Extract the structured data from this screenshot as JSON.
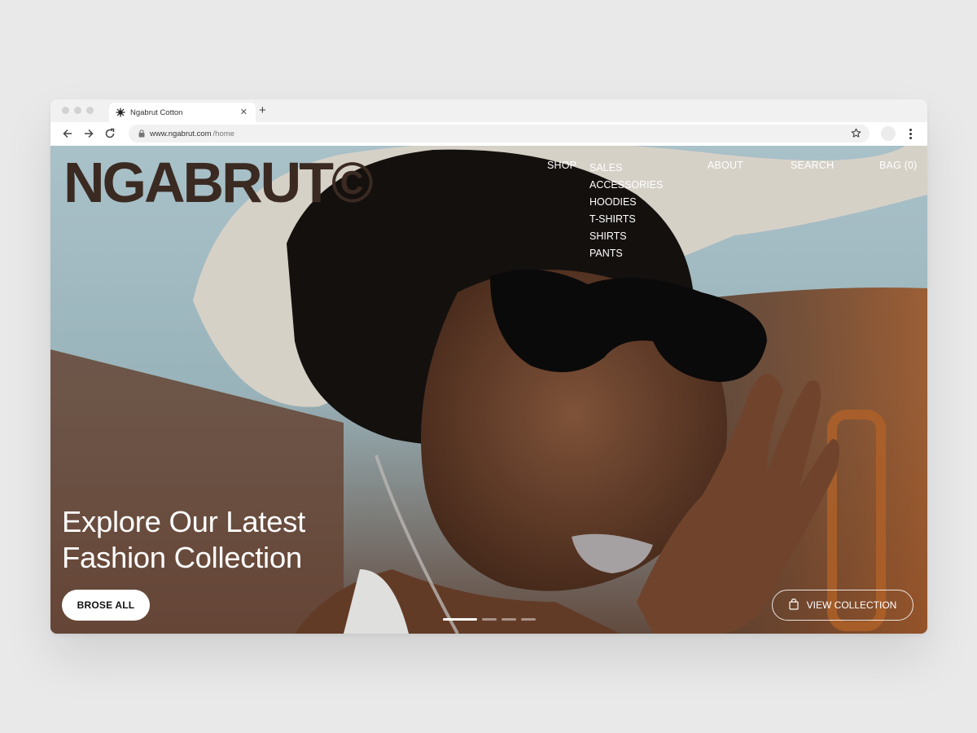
{
  "browser": {
    "tab_title": "Ngabrut Cotton",
    "url_domain": "www.ngabrut.com",
    "url_path": "/home"
  },
  "site": {
    "logo": "NGABRUT©",
    "nav": {
      "shop": "SHOP",
      "about": "ABOUT",
      "search": "SEARCH",
      "bag": "BAG (0)"
    },
    "shop_menu": [
      "SALES",
      "ACCESSORIES",
      "HOODIES",
      "T-SHIRTS",
      "SHIRTS",
      "PANTS"
    ]
  },
  "hero": {
    "headline_line1": "Explore Our Latest",
    "headline_line2": "Fashion Collection",
    "primary_button": "BROSE ALL",
    "secondary_button": "VIEW COLLECTION",
    "slides_total": 4,
    "active_slide": 1
  },
  "icons": {
    "back": "arrow-left-icon",
    "forward": "arrow-right-icon",
    "reload": "reload-icon",
    "lock": "lock-icon",
    "bookmark": "star-icon",
    "menu": "kebab-menu-icon",
    "bag": "shopping-bag-icon",
    "favicon": "sunburst-icon"
  }
}
